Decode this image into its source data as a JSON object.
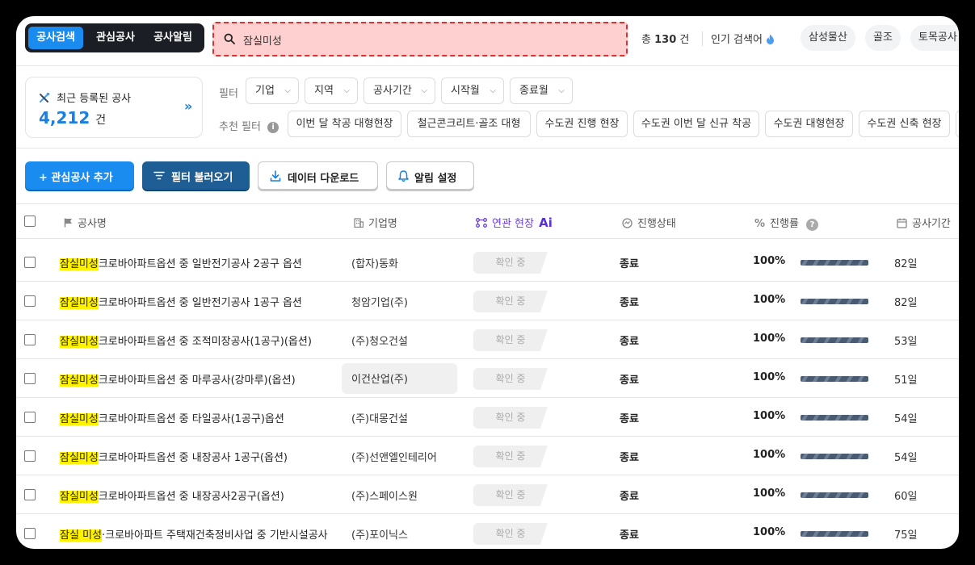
{
  "tabs": [
    {
      "label": "공사검색",
      "active": true
    },
    {
      "label": "관심공사",
      "active": false
    },
    {
      "label": "공사알림",
      "active": false
    }
  ],
  "search": {
    "value": "잠실미성",
    "icon": "search-icon"
  },
  "result": {
    "prefix": "총",
    "count": "130",
    "suffix": "건"
  },
  "popular": {
    "label": "인기 검색어",
    "keywords": [
      "삼성물산",
      "골조",
      "토목공사"
    ]
  },
  "recent": {
    "title": "최근 등록된 공사",
    "count": "4,212",
    "unit": "건",
    "arrow": "»"
  },
  "filters": {
    "label": "필터",
    "dropdowns": [
      "기업",
      "지역",
      "공사기간",
      "시작월",
      "종료월"
    ],
    "recommended_label": "추천 필터",
    "recommended": [
      "이번 달 착공 대형현장",
      "철근콘크리트·골조 대형",
      "수도권 진행 현장",
      "수도권 이번 달 신규 착공",
      "수도권 대형현장",
      "수도권 신축 현장"
    ]
  },
  "actions": {
    "add": "+ 관심공사 추가",
    "load": "필터 불러오기",
    "download": "데이터 다운로드",
    "alert": "알림 설정"
  },
  "table": {
    "headers": {
      "name": "공사명",
      "company": "기업명",
      "linked": "연관 현장",
      "linked_badge": "Ai",
      "status": "진행상태",
      "progress": "진행률",
      "period": "공사기간"
    },
    "rows": [
      {
        "highlight": "잠실미성",
        "rest": "크로바아파트옵션 중 일반전기공사 2공구 옵션",
        "company": "(합자)동화",
        "linked": "확인 중",
        "status": "종료",
        "progress": "100%",
        "progress_value": 1.0,
        "period": "82일"
      },
      {
        "highlight": "잠실미성",
        "rest": "크로바아파트옵션 중 일반전기공사 1공구 옵션",
        "company": "청암기업(주)",
        "linked": "확인 중",
        "status": "종료",
        "progress": "100%",
        "progress_value": 1.0,
        "period": "82일"
      },
      {
        "highlight": "잠실미성",
        "rest": "크로바아파트옵션 중 조적미장공사(1공구)(옵션)",
        "company": "(주)청오건설",
        "linked": "확인 중",
        "status": "종료",
        "progress": "100%",
        "progress_value": 1.0,
        "period": "53일"
      },
      {
        "highlight": "잠실미성",
        "rest": "크로바아파트옵션 중 마루공사(강마루)(옵션)",
        "company": "이건산업(주)",
        "linked": "확인 중",
        "status": "종료",
        "progress": "100%",
        "progress_value": 1.0,
        "period": "51일"
      },
      {
        "highlight": "잠실미성",
        "rest": "크로바아파트옵션 중 타일공사(1공구)옵션",
        "company": "(주)대몽건설",
        "linked": "확인 중",
        "status": "종료",
        "progress": "100%",
        "progress_value": 1.0,
        "period": "54일"
      },
      {
        "highlight": "잠실미성",
        "rest": "크로바아파트옵션 중 내장공사 1공구(옵션)",
        "company": "(주)선앤엘인테리어",
        "linked": "확인 중",
        "status": "종료",
        "progress": "100%",
        "progress_value": 1.0,
        "period": "54일"
      },
      {
        "highlight": "잠실미성",
        "rest": "크로바아파트옵션 중 내장공사2공구(옵션)",
        "company": "(주)스페이스원",
        "linked": "확인 중",
        "status": "종료",
        "progress": "100%",
        "progress_value": 1.0,
        "period": "60일"
      },
      {
        "highlight": "잠실 미성",
        "rest": "·크로바아파트 주택재건축정비사업 중 기반시설공사",
        "company": "(주)포이닉스",
        "linked": "확인 중",
        "status": "종료",
        "progress": "100%",
        "progress_value": 1.0,
        "period": "75일"
      }
    ]
  }
}
